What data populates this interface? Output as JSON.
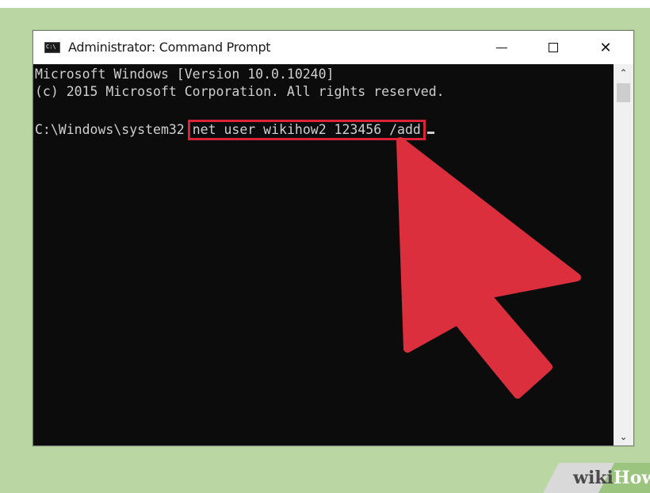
{
  "window": {
    "title": "Administrator: Command Prompt",
    "icon": "cmd-app-icon",
    "icon_text": "C:\\",
    "controls": [
      "minimize-icon",
      "maximize-icon",
      "close-icon"
    ],
    "close_glyph": "✕"
  },
  "console": {
    "line1": "Microsoft Windows [Version 10.0.10240]",
    "line2": "(c) 2015 Microsoft Corporation. All rights reserved.",
    "prompt": "C:\\Windows\\system32",
    "command": "net user wikihow2 123456 /add"
  },
  "scrollbar": {
    "up": "⌃",
    "down": "⌄"
  },
  "annotation": {
    "highlight_color": "#d92337",
    "arrow_color": "#dc2f3e"
  },
  "watermark": {
    "wiki": "wiki",
    "how": "How"
  },
  "colors": {
    "background": "#bad7a3",
    "console_bg": "#0c0c0c",
    "console_text": "#cfcfcf"
  }
}
